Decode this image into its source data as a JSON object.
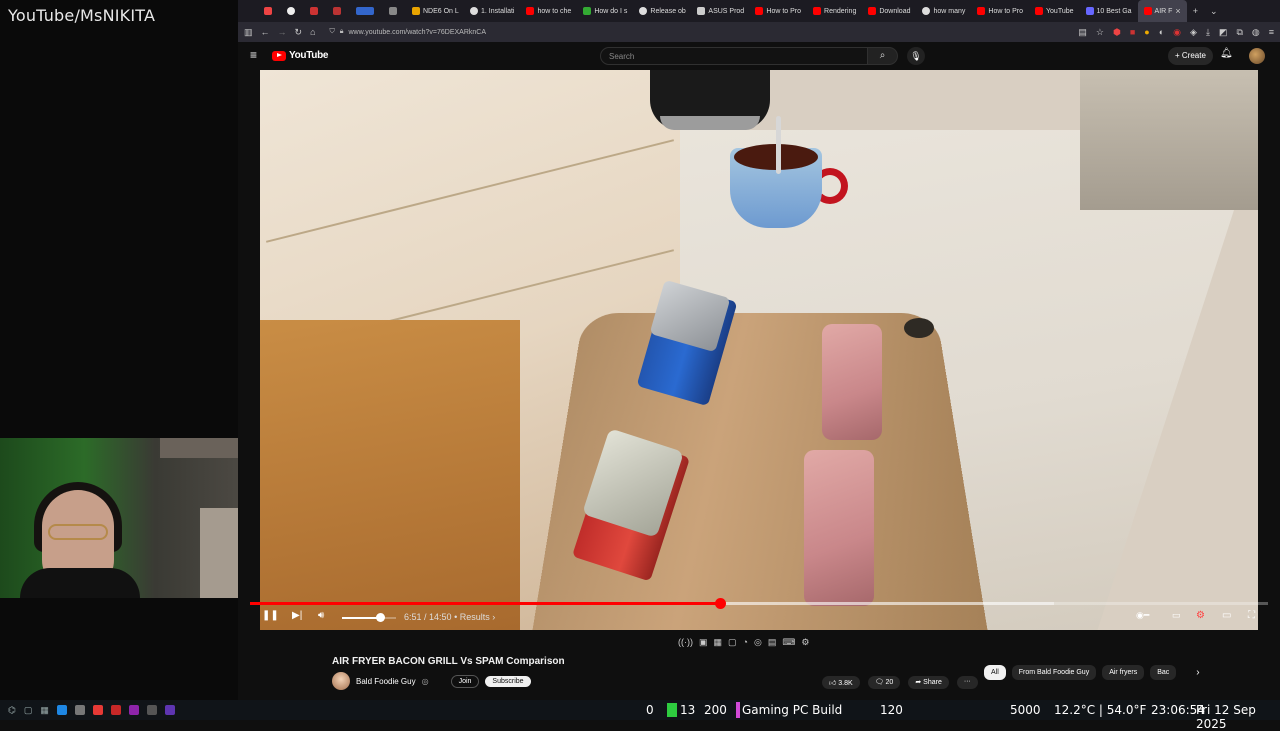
{
  "stream": {
    "channel_tag": "YouTube/MsNIKITA"
  },
  "browser": {
    "tabs": [
      {
        "label": "",
        "icon_color": "#e44"
      },
      {
        "label": "",
        "icon_color": "#eee"
      },
      {
        "label": "",
        "icon_color": "#c33"
      },
      {
        "label": "",
        "icon_color": "#b33"
      },
      {
        "label": "",
        "icon_color": "#36c"
      },
      {
        "label": "",
        "icon_color": "#888"
      },
      {
        "label": "NDE6 On L",
        "icon_color": "#e9a400"
      },
      {
        "label": "1. Installati",
        "icon_color": "#ddd"
      },
      {
        "label": "how to che",
        "icon_color": "#f00"
      },
      {
        "label": "How do I s",
        "icon_color": "#3a3"
      },
      {
        "label": "Release ob",
        "icon_color": "#ddd"
      },
      {
        "label": "ASUS Prod",
        "icon_color": "#ccc"
      },
      {
        "label": "How to Pro",
        "icon_color": "#f00"
      },
      {
        "label": "Rendering",
        "icon_color": "#f00"
      },
      {
        "label": "Download",
        "icon_color": "#f00"
      },
      {
        "label": "how many",
        "icon_color": "#ddd"
      },
      {
        "label": "How to Pro",
        "icon_color": "#f00"
      },
      {
        "label": "YouTube",
        "icon_color": "#f00"
      },
      {
        "label": "10 Best Ga",
        "icon_color": "#66f"
      },
      {
        "label": "AIR F",
        "icon_color": "#f00"
      }
    ],
    "url": "www.youtube.com/watch?v=76DEXARknCA"
  },
  "youtube": {
    "logo_text": "YouTube",
    "search_placeholder": "Search",
    "create_label": "+ Create"
  },
  "player": {
    "time_label": "6:51 / 14:50",
    "chapter_label": "• Results ›",
    "progress_fraction": 0.462,
    "buffer_fraction": 0.79,
    "volume_fraction": 0.7
  },
  "video_info": {
    "title": "AIR FRYER BACON GRILL Vs SPAM Comparison",
    "channel_name": "Bald Foodie Guy",
    "join_label": "Join",
    "subscribe_label": "Subscribe",
    "likes": "3.8K",
    "comments": "20",
    "share_label": "Share",
    "more_label": "···"
  },
  "chips": [
    "All",
    "From Bald Foodie Guy",
    "Air fryers",
    "Bac"
  ],
  "taskbar": {
    "stat_zero": "0",
    "stat_green": "13",
    "stat_200": "200",
    "build_name": "Gaming PC Build",
    "stat_120": "120",
    "stat_5000": "5000",
    "weather": "12.2°C | 54.0°F",
    "clock": "23:06:54",
    "date": "Fri 12 Sep 2025"
  }
}
